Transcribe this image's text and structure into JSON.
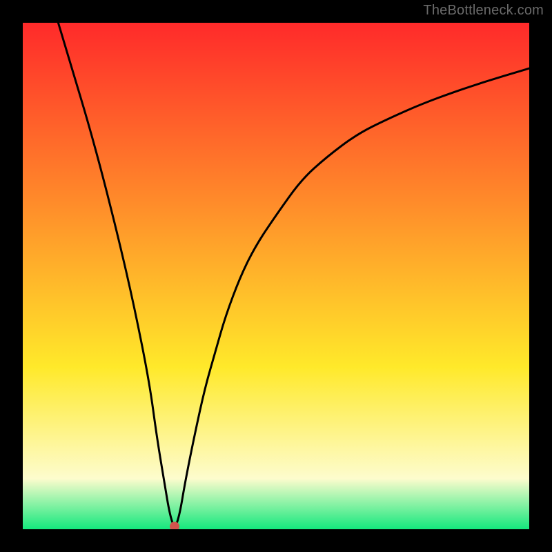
{
  "watermark": "TheBottleneck.com",
  "colors": {
    "red": "#ff2a2a",
    "orange": "#ff8a2a",
    "yellow": "#ffe92a",
    "pale_yellow": "#fdfccd",
    "green": "#14e87d",
    "curve": "#000000",
    "dot": "#d1544d",
    "black": "#000000"
  },
  "chart_data": {
    "type": "line",
    "title": "",
    "xlabel": "",
    "ylabel": "",
    "xlim": [
      0,
      100
    ],
    "ylim": [
      0,
      100
    ],
    "x": [
      7,
      10,
      13,
      16,
      19,
      22,
      25,
      26.5,
      28,
      29,
      30,
      31,
      32,
      34,
      36,
      38,
      40,
      43,
      46,
      50,
      55,
      60,
      66,
      72,
      80,
      90,
      100
    ],
    "values": [
      100,
      90,
      80,
      69,
      57,
      44,
      29,
      18,
      9,
      3,
      0,
      3,
      9,
      19,
      28,
      35,
      42,
      50,
      56,
      62,
      69,
      73.5,
      78,
      81,
      84.5,
      88,
      91
    ],
    "annotations": [
      {
        "name": "marker",
        "x": 30,
        "y": 0
      }
    ]
  }
}
